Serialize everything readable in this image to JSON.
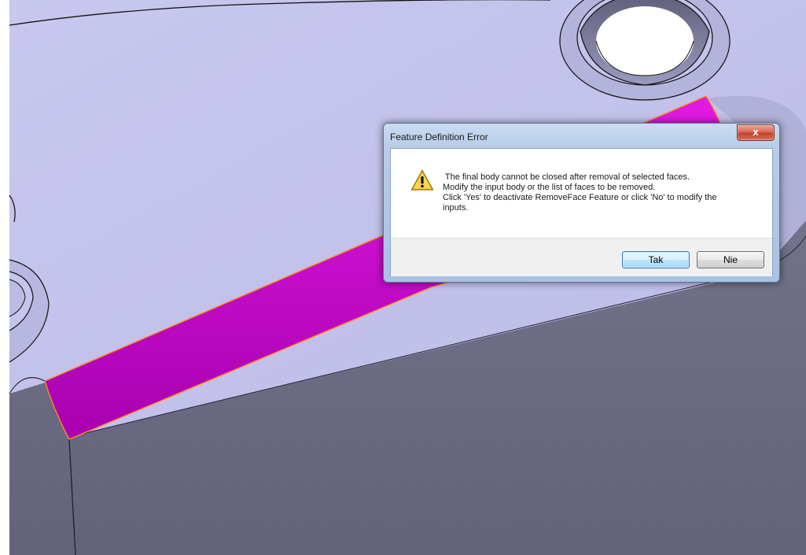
{
  "dialog": {
    "title": "Feature Definition Error",
    "close_symbol": "x",
    "icon": "warning-icon",
    "message_lines": [
      " The final body cannot be closed after removal of selected faces.",
      "Modify the input body or the list of faces to be removed.",
      "Click 'Yes' to deactivate RemoveFace Feature or click 'No' to modify the",
      "inputs."
    ],
    "yes_label": "Tak",
    "no_label": "Nie"
  },
  "colors": {
    "part_top_face": "#c3c2ea",
    "part_side_face": "#6a6a82",
    "selected_face": "#d800d8",
    "selection_edge": "#ff8a1e"
  }
}
